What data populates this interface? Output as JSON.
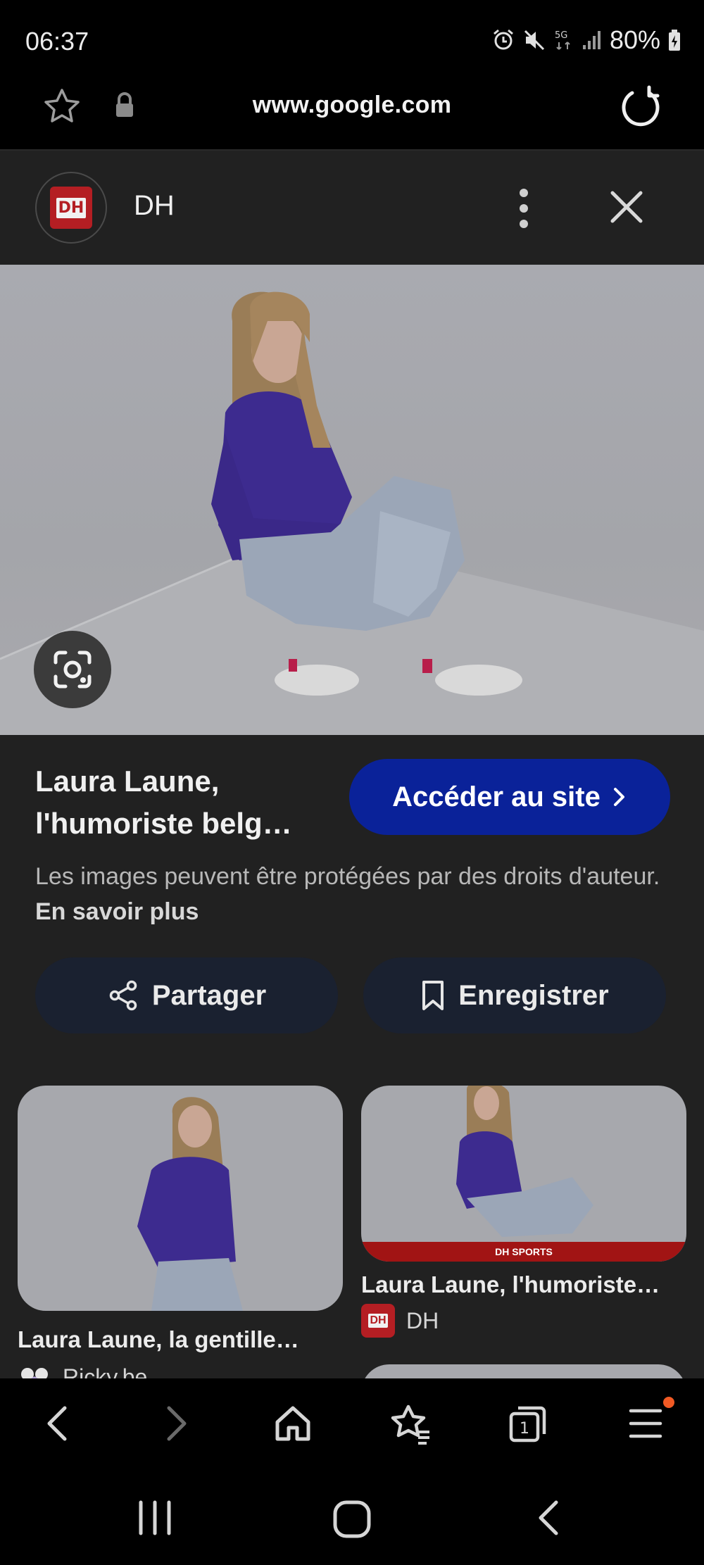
{
  "status_bar": {
    "time": "06:37",
    "network": "5G",
    "battery": "80%"
  },
  "url_bar": {
    "url": "www.google.com",
    "icons": [
      "star-icon",
      "lock-icon",
      "reload-icon"
    ]
  },
  "source": {
    "logo_text": "DH",
    "name": "DH"
  },
  "result": {
    "title": "Laura Laune, l'humoriste belg…",
    "visit_button": "Accéder au site",
    "copyright_text": "Les images peuvent être protégées par des droits d'auteur.",
    "learn_more": "En savoir plus",
    "share_button": "Partager",
    "save_button": "Enregistrer"
  },
  "related": [
    {
      "title": "Laura Laune, la gentille…",
      "source": "Ricky.be"
    },
    {
      "title": "Laura Laune, l'humoriste…",
      "source": "DH",
      "logo_text": "DH",
      "band_text": "DH SPORTS"
    }
  ],
  "bottom_toolbar": {
    "tabs_count": "1",
    "icons": [
      "back-icon",
      "forward-icon",
      "home-icon",
      "bookmarks-icon",
      "tabs-icon",
      "menu-icon"
    ]
  },
  "colors": {
    "accent_button": "#0a2299",
    "panel_bg": "#212121",
    "brand_red": "#b41e23",
    "notification_dot": "#f15a24"
  }
}
